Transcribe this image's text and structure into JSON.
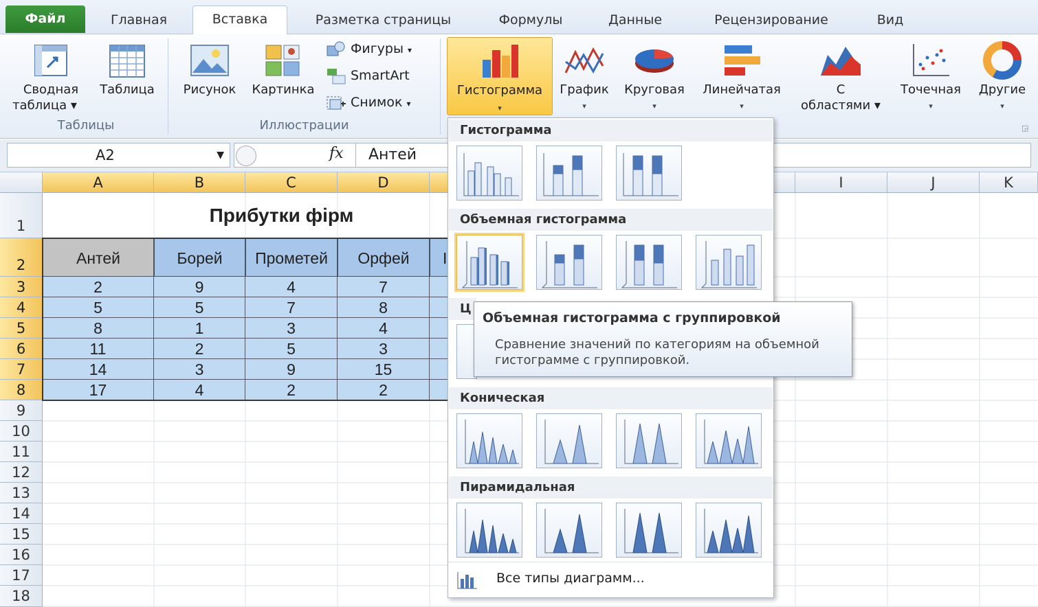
{
  "tabs": {
    "file": "Файл",
    "home": "Главная",
    "insert": "Вставка",
    "layout": "Разметка страницы",
    "formulas": "Формулы",
    "data": "Данные",
    "review": "Рецензирование",
    "view": "Вид"
  },
  "ribbon": {
    "pivot_line1": "Сводная",
    "pivot_line2": "таблица",
    "table": "Таблица",
    "group_tables": "Таблицы",
    "picture": "Рисунок",
    "clipart": "Картинка",
    "shapes": "Фигуры",
    "smartart": "SmartArt",
    "screenshot": "Снимок",
    "group_illustrations": "Иллюстрации",
    "column": "Гистограмма",
    "line": "График",
    "pie": "Круговая",
    "bar": "Линейчатая",
    "area_line1": "С",
    "area_line2": "областями",
    "scatter": "Точечная",
    "other": "Другие"
  },
  "formula_bar": {
    "name_box": "A2",
    "fx": "fx",
    "value": "Антей"
  },
  "columns": [
    "A",
    "B",
    "C",
    "D",
    "I",
    "J",
    "K"
  ],
  "rows": [
    "1",
    "2",
    "3",
    "4",
    "5",
    "6",
    "7",
    "8",
    "9",
    "10",
    "11",
    "12",
    "13",
    "14",
    "15",
    "16",
    "17",
    "18"
  ],
  "sheet": {
    "title": "Прибутки фірм",
    "headers": [
      "Антей",
      "Борей",
      "Прометей",
      "Орфей"
    ],
    "data": [
      [
        "2",
        "9",
        "4",
        "7"
      ],
      [
        "5",
        "5",
        "7",
        "8"
      ],
      [
        "8",
        "1",
        "3",
        "4"
      ],
      [
        "11",
        "2",
        "5",
        "3"
      ],
      [
        "14",
        "3",
        "9",
        "15"
      ],
      [
        "17",
        "4",
        "2",
        "2"
      ]
    ],
    "partial_header": "I"
  },
  "dropdown": {
    "sec_column": "Гистограмма",
    "sec_3d": "Объемная гистограмма",
    "sec_cyl_partial": "Ц",
    "sec_cone": "Коническая",
    "sec_pyramid": "Пирамидальная",
    "all_types": "Все типы диаграмм..."
  },
  "tooltip": {
    "title": "Объемная гистограмма с группировкой",
    "desc": "Сравнение значений по категориям на объемной гистограмме с группировкой."
  },
  "colors": {
    "file_tab": "#2e8a2e",
    "selection": "#c1daf4",
    "header_blue": "#a8c6e9",
    "highlight": "#f9c844"
  }
}
